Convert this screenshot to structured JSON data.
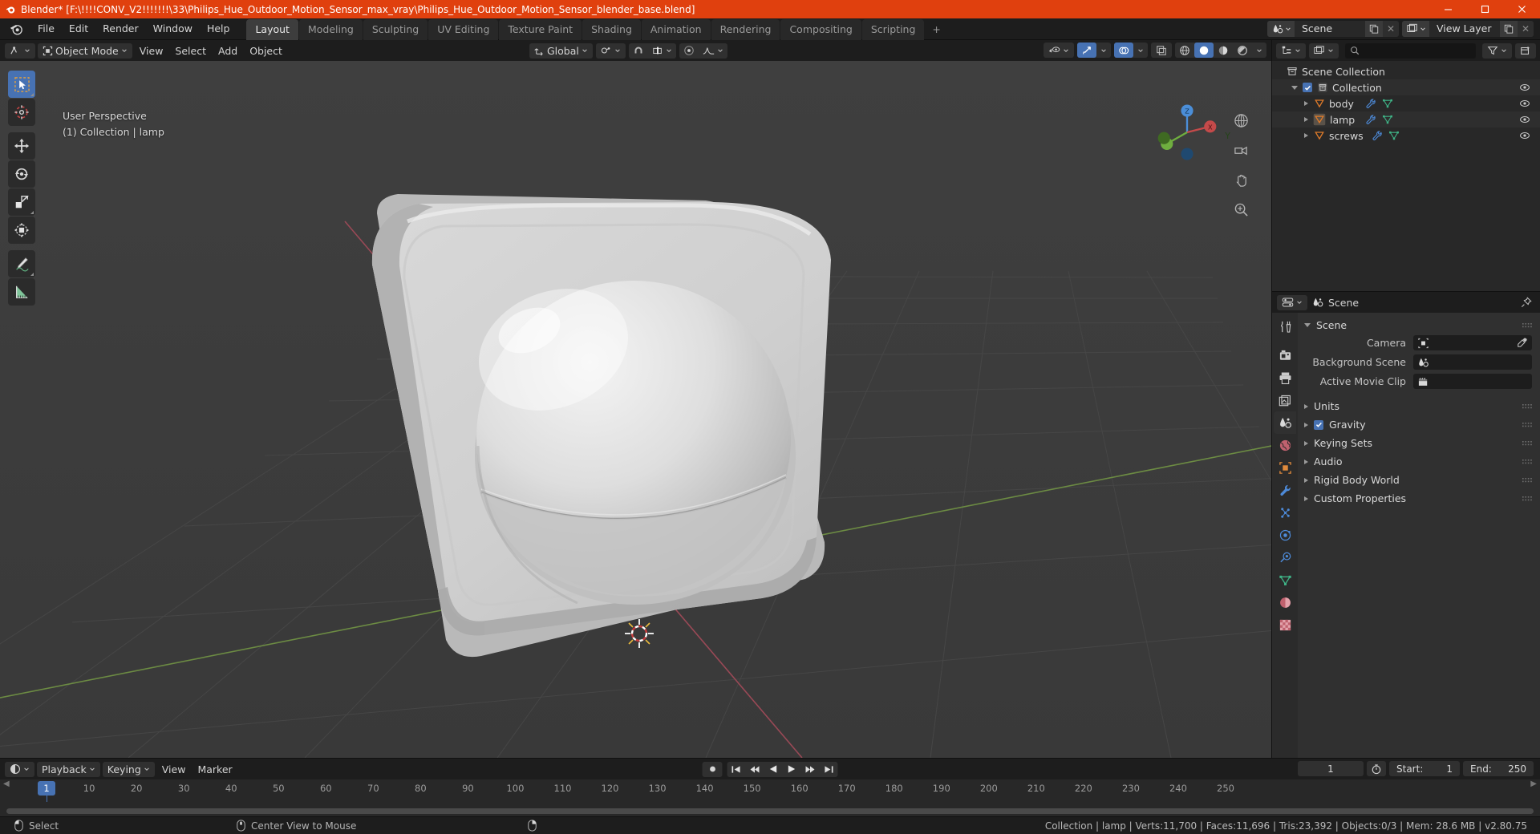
{
  "window": {
    "title": "Blender* [F:\\!!!!CONV_V2!!!!!!!\\33\\Philips_Hue_Outdoor_Motion_Sensor_max_vray\\Philips_Hue_Outdoor_Motion_Sensor_blender_base.blend]",
    "title_bar_color": "#e0400e",
    "minimize": "minimize-button",
    "maximize": "maximize-button",
    "close": "close-button"
  },
  "topbar": {
    "menus": [
      "File",
      "Edit",
      "Render",
      "Window",
      "Help"
    ],
    "workspaces": [
      {
        "label": "Layout",
        "active": true
      },
      {
        "label": "Modeling",
        "active": false
      },
      {
        "label": "Sculpting",
        "active": false
      },
      {
        "label": "UV Editing",
        "active": false
      },
      {
        "label": "Texture Paint",
        "active": false
      },
      {
        "label": "Shading",
        "active": false
      },
      {
        "label": "Animation",
        "active": false
      },
      {
        "label": "Rendering",
        "active": false
      },
      {
        "label": "Compositing",
        "active": false
      },
      {
        "label": "Scripting",
        "active": false
      }
    ],
    "add_workspace": "+",
    "scene_name": "Scene",
    "view_layer_name": "View Layer"
  },
  "viewport": {
    "mode": "Object Mode",
    "menus": [
      "View",
      "Select",
      "Add",
      "Object"
    ],
    "transform_orientation": "Global",
    "overlay_line1": "User Perspective",
    "overlay_line2": "(1) Collection | lamp",
    "axis_x": "X",
    "axis_y": "Y",
    "axis_z": "Z",
    "tools": [
      {
        "name": "tweak-select-tool",
        "active": true
      },
      {
        "name": "cursor-tool",
        "active": false
      },
      {
        "name": "move-tool",
        "active": false
      },
      {
        "name": "rotate-tool",
        "active": false
      },
      {
        "name": "scale-tool",
        "active": false
      },
      {
        "name": "transform-tool",
        "active": false
      },
      {
        "name": "annotate-tool",
        "active": false
      },
      {
        "name": "measure-tool",
        "active": false
      }
    ],
    "bg_color": "#3b3b3b",
    "grid_color": "#4a4a4a",
    "x_axis_color": "#9c4a5a",
    "y_axis_color": "#6a8a3f"
  },
  "outliner": {
    "display_mode": "view-layer",
    "search_placeholder": "",
    "rows": [
      {
        "label": "Scene Collection",
        "indent": 0,
        "icon": "collection-icon",
        "has_eye": false,
        "selected": false
      },
      {
        "label": "Collection",
        "indent": 1,
        "icon": "collection-icon",
        "has_eye": true,
        "selected": false,
        "expanded": true,
        "checkbox": true
      },
      {
        "label": "body",
        "indent": 2,
        "icon": "mesh-object-icon",
        "has_eye": true,
        "selected": false,
        "modifier": true,
        "mesh": true
      },
      {
        "label": "lamp",
        "indent": 2,
        "icon": "mesh-object-icon",
        "has_eye": true,
        "selected": true,
        "modifier": true,
        "mesh": true
      },
      {
        "label": "screws",
        "indent": 2,
        "icon": "mesh-object-icon",
        "has_eye": true,
        "selected": false,
        "modifier": true,
        "mesh": true
      }
    ]
  },
  "properties": {
    "breadcrumb": "Scene",
    "tabs": [
      {
        "name": "tool-tab",
        "active": false
      },
      {
        "name": "render-tab",
        "active": false
      },
      {
        "name": "output-tab",
        "active": false
      },
      {
        "name": "view-layer-tab",
        "active": false
      },
      {
        "name": "scene-tab",
        "active": true
      },
      {
        "name": "world-tab",
        "active": false
      },
      {
        "name": "object-tab",
        "active": false
      },
      {
        "name": "modifier-tab",
        "active": false
      },
      {
        "name": "particles-tab",
        "active": false
      },
      {
        "name": "physics-tab",
        "active": false
      },
      {
        "name": "constraint-tab",
        "active": false
      },
      {
        "name": "data-tab",
        "active": false
      },
      {
        "name": "material-tab",
        "active": false
      },
      {
        "name": "texture-tab",
        "active": false
      }
    ],
    "scene_panel_title": "Scene",
    "fields": [
      {
        "label": "Camera",
        "value": "",
        "icon": "camera-icon",
        "eyedropper": true
      },
      {
        "label": "Background Scene",
        "value": "",
        "icon": "scene-icon",
        "eyedropper": false
      },
      {
        "label": "Active Movie Clip",
        "value": "",
        "icon": "clip-icon",
        "eyedropper": false
      }
    ],
    "panels": [
      {
        "label": "Units",
        "checkbox": false,
        "checked": false
      },
      {
        "label": "Gravity",
        "checkbox": true,
        "checked": true
      },
      {
        "label": "Keying Sets",
        "checkbox": false,
        "checked": false
      },
      {
        "label": "Audio",
        "checkbox": false,
        "checked": false
      },
      {
        "label": "Rigid Body World",
        "checkbox": false,
        "checked": false
      },
      {
        "label": "Custom Properties",
        "checkbox": false,
        "checked": false
      }
    ]
  },
  "timeline": {
    "menus": [
      "Playback",
      "Keying",
      "View",
      "Marker"
    ],
    "current_frame": "1",
    "start_label": "Start:",
    "start_value": "1",
    "end_label": "End:",
    "end_value": "250",
    "ticks": [
      "10",
      "20",
      "30",
      "40",
      "50",
      "60",
      "70",
      "80",
      "90",
      "100",
      "110",
      "120",
      "130",
      "140",
      "150",
      "160",
      "170",
      "180",
      "190",
      "200",
      "210",
      "220",
      "230",
      "240",
      "250"
    ],
    "tick_values": [
      10,
      20,
      30,
      40,
      50,
      60,
      70,
      80,
      90,
      100,
      110,
      120,
      130,
      140,
      150,
      160,
      170,
      180,
      190,
      200,
      210,
      220,
      230,
      240,
      250
    ],
    "playhead_frame": 1,
    "playhead_color": "#4772b3"
  },
  "statusbar": {
    "left_items": [
      {
        "icon": "mouse-left-icon",
        "label": "Select"
      },
      {
        "icon": "mouse-middle-icon",
        "label": "Center View to Mouse"
      },
      {
        "icon": "mouse-right-icon",
        "label": ""
      }
    ],
    "right_text": "Collection | lamp | Verts:11,700 | Faces:11,696 | Tris:23,392 | Objects:0/3 | Mem: 28.6 MB | v2.80.75"
  }
}
